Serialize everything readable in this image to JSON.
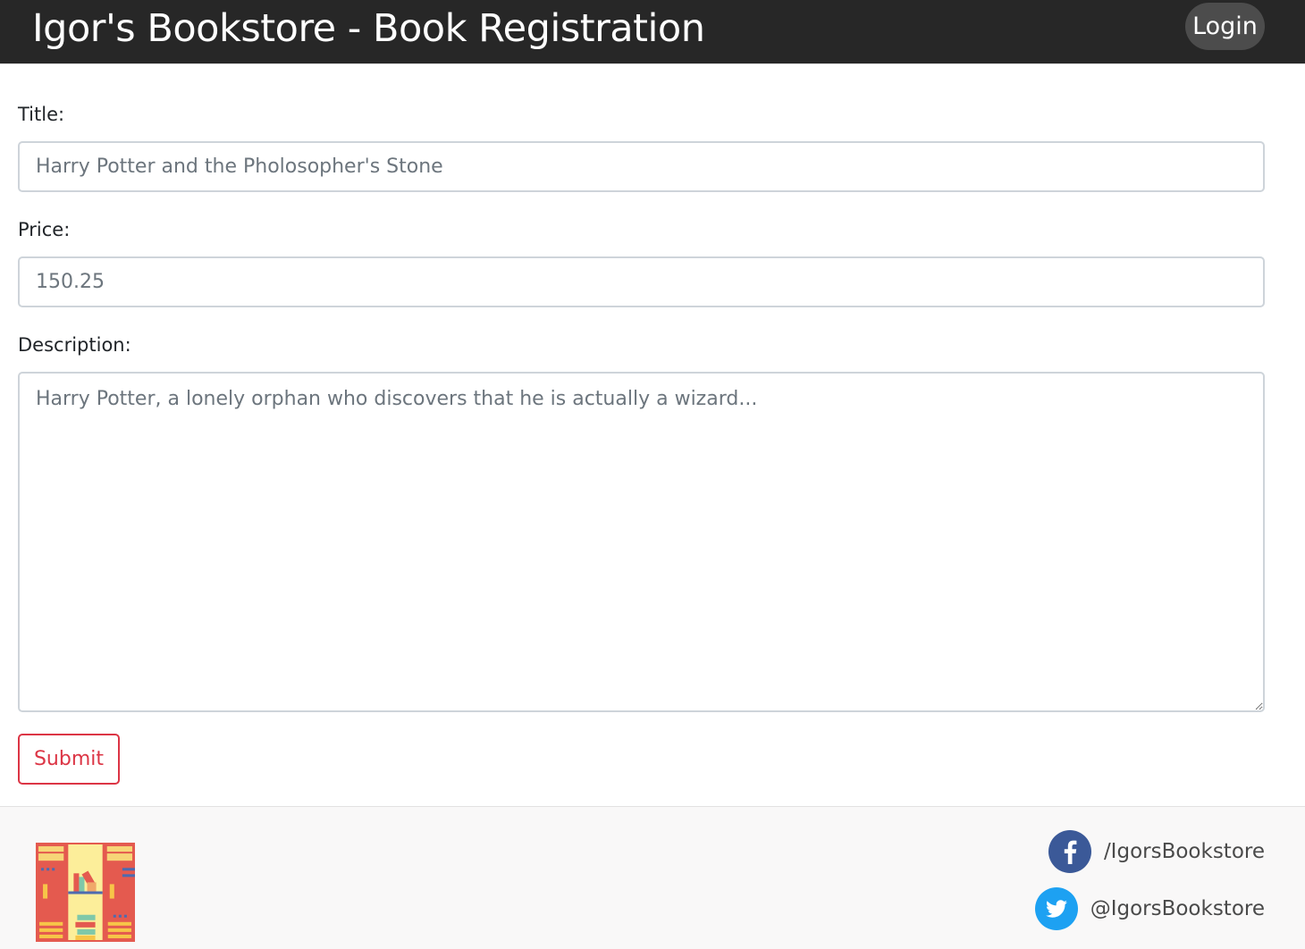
{
  "header": {
    "title": "Igor's Bookstore - Book Registration",
    "login_label": "Login"
  },
  "form": {
    "title_label": "Title:",
    "title_placeholder": "Harry Potter and the Pholosopher's Stone",
    "price_label": "Price:",
    "price_placeholder": "150.25",
    "description_label": "Description:",
    "description_placeholder": "Harry Potter, a lonely orphan who discovers that he is actually a wizard...",
    "submit_label": "Submit"
  },
  "footer": {
    "logo_icon": "bookshelf-icon",
    "facebook": {
      "icon": "facebook-icon",
      "handle": "/IgorsBookstore"
    },
    "twitter": {
      "icon": "twitter-icon",
      "handle": "@IgorsBookstore"
    }
  },
  "colors": {
    "navbar_bg": "#272727",
    "login_bg": "#4c4c4c",
    "submit_accent": "#dc3545",
    "footer_bg": "#f9f8f8",
    "facebook_blue": "#3b5998",
    "twitter_blue": "#1da1f2"
  }
}
